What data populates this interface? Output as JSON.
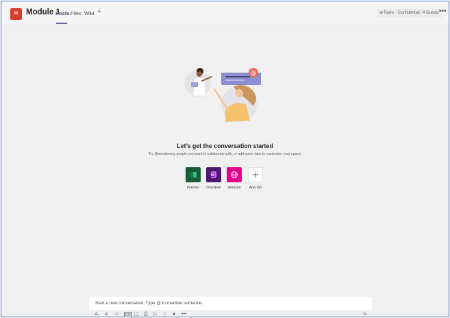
{
  "header": {
    "team_initials": "IN",
    "channel_name": "Module 1",
    "tabs": [
      {
        "label": "Posts",
        "active": true
      },
      {
        "label": "Files",
        "active": false
      },
      {
        "label": "Wiki",
        "active": false
      }
    ],
    "add_tab_icon": "plus-icon",
    "team_label": "Team",
    "confidential_label": "Confidential",
    "guests_label": "4 Guests",
    "more_icon": "ellipsis-icon"
  },
  "empty_state": {
    "heading": "Let’s get the conversation started",
    "subtext": "Try @mentioning people you want to collaborate with, or add some tabs to customise your space."
  },
  "apps": [
    {
      "label": "Planner",
      "icon": "planner-icon",
      "color": "#077568"
    },
    {
      "label": "OneNote",
      "icon": "onenote-icon",
      "color": "#7719aa"
    },
    {
      "label": "Website",
      "icon": "globe-icon",
      "color": "#e3008c"
    },
    {
      "label": "Add tab",
      "icon": "plus-icon",
      "color": "#ffffff"
    }
  ],
  "compose": {
    "placeholder": "Start a new conversation. Type @ to mention someone."
  },
  "toolbar": {
    "icons": [
      "format-icon",
      "attach-icon",
      "emoji-icon",
      "gif-icon",
      "sticker-icon",
      "meet-icon",
      "stream-icon",
      "praise-icon",
      "more-apps-icon",
      "more-icon"
    ],
    "send_icon": "send-icon"
  },
  "colors": {
    "accent": "#6264a7",
    "team_avatar": "#d83b2b",
    "frame_border": "#4a72b8",
    "background": "#f0f0f0"
  }
}
